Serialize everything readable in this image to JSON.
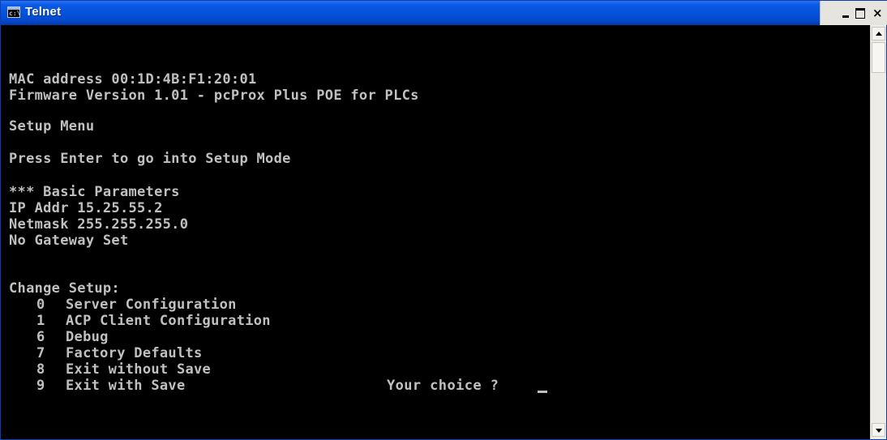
{
  "window": {
    "title": "Telnet",
    "icon": "console-icon",
    "icon_glyph": "c:\\",
    "controls": {
      "minimize": "minimize-icon",
      "maximize": "maximize-icon",
      "close": "close-icon",
      "close_glyph": "×"
    }
  },
  "console": {
    "lines": [
      "MAC address 00:1D:4B:F1:20:01",
      "Firmware Version 1.01 - pcProx Plus POE for PLCs",
      "Setup Menu",
      "Press Enter to go into Setup Mode",
      "*** Basic Parameters",
      "IP Addr 15.25.55.2",
      "Netmask 255.255.255.0",
      "No Gateway Set",
      "Change Setup:"
    ],
    "options": [
      {
        "num": "0",
        "label": "Server Configuration"
      },
      {
        "num": "1",
        "label": "ACP Client Configuration"
      },
      {
        "num": "6",
        "label": "Debug"
      },
      {
        "num": "7",
        "label": "Factory Defaults"
      },
      {
        "num": "8",
        "label": "Exit without Save"
      },
      {
        "num": "9",
        "label": "Exit with Save"
      }
    ],
    "prompt": "Your choice ?",
    "text_color": "#c0c0c0",
    "background_color": "#000000"
  },
  "scrollbar": {
    "up_icon": "scroll-up-arrow-icon",
    "down_icon": "scroll-down-arrow-icon"
  }
}
